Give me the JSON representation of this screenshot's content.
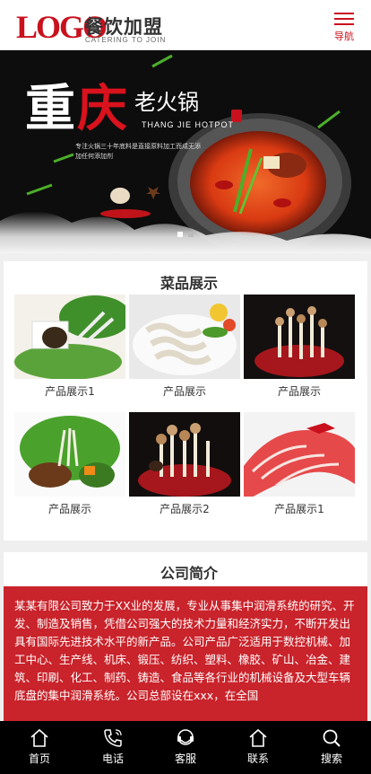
{
  "header": {
    "logo_mark": "LOGO",
    "logo_name": "餐饮加盟",
    "logo_slogan": "CATERING TO JOIN",
    "nav_label": "导航"
  },
  "banner": {
    "title_char_1": "重",
    "title_char_2": "庆",
    "subtitle": "老火锅",
    "english": "THANG JIE HOTPOT",
    "description": "专注火锅三十年底料是直接原料加工而成无添加任何添加剂",
    "slides": 2,
    "active_slide": 1
  },
  "products": {
    "title": "菜品展示",
    "items": [
      {
        "caption": "产品展示1"
      },
      {
        "caption": "产品展示"
      },
      {
        "caption": "产品展示"
      },
      {
        "caption": "产品展示"
      },
      {
        "caption": "产品展示2"
      },
      {
        "caption": "产品展示1"
      }
    ]
  },
  "about": {
    "title": "公司简介",
    "text": "某某有限公司致力于XX业的发展，专业从事集中润滑系统的研究、开发、制造及销售，凭借公司强大的技术力量和经济实力，不断开发出具有国际先进技术水平的新产品。公司产品广泛适用于数控机械、加工中心、生产线、机床、锻压、纺织、塑料、橡胶、矿山、冶金、建筑、印刷、化工、制药、铸造、食品等各行业的机械设备及大型车辆底盘的集中润滑系统。公司总部设在xxx，在全国"
  },
  "footer": {
    "items": [
      {
        "label": "首页",
        "icon": "home-icon"
      },
      {
        "label": "电话",
        "icon": "phone-icon"
      },
      {
        "label": "客服",
        "icon": "headset-icon"
      },
      {
        "label": "联系",
        "icon": "contact-icon"
      },
      {
        "label": "搜索",
        "icon": "search-icon"
      }
    ]
  },
  "colors": {
    "brand_red": "#c8111d",
    "about_red": "#c9232b",
    "footer_bg": "#000000"
  }
}
